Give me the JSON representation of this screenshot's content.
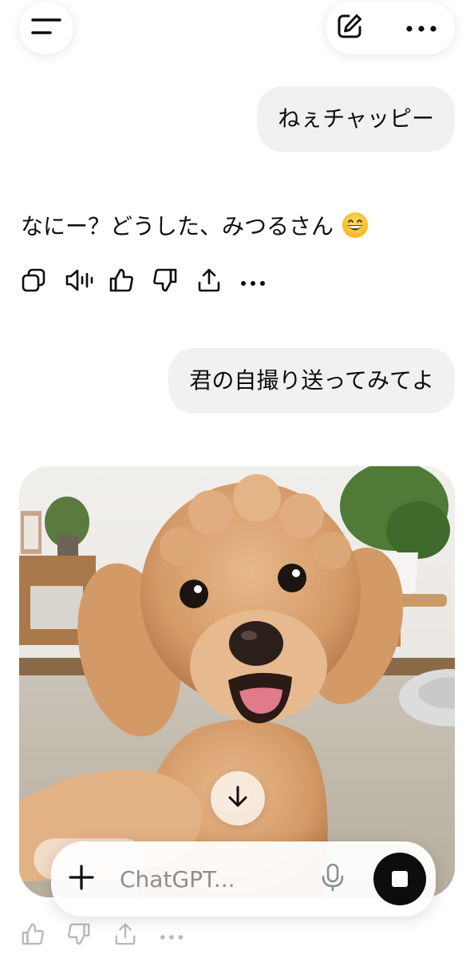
{
  "header": {
    "menu_icon": "sidebar-menu-icon",
    "new_chat_icon": "pencil-square-icon",
    "more_icon": "ellipsis-icon"
  },
  "messages": [
    {
      "role": "user",
      "text": "ねぇチャッピー"
    },
    {
      "role": "assistant",
      "text": "なにー？どうした、みつるさん",
      "emoji": "grinning-face-emoji"
    },
    {
      "role": "user",
      "text": "君の自撮り送ってみてよ"
    },
    {
      "role": "assistant",
      "image": "dog-selfie-image"
    }
  ],
  "assistant_actions": [
    "copy-icon",
    "read-aloud-icon",
    "thumbs-up-icon",
    "thumbs-down-icon",
    "share-icon",
    "more-icon"
  ],
  "composer": {
    "placeholder": "ChatGPT...",
    "plus_icon": "plus-icon",
    "mic_icon": "microphone-icon",
    "stop_icon": "stop-icon"
  },
  "colors": {
    "bubble_bg": "#f1f1f1",
    "text": "#0d0d0d",
    "stop_button": "#0d0d0d",
    "placeholder": "#8e8e8e"
  }
}
